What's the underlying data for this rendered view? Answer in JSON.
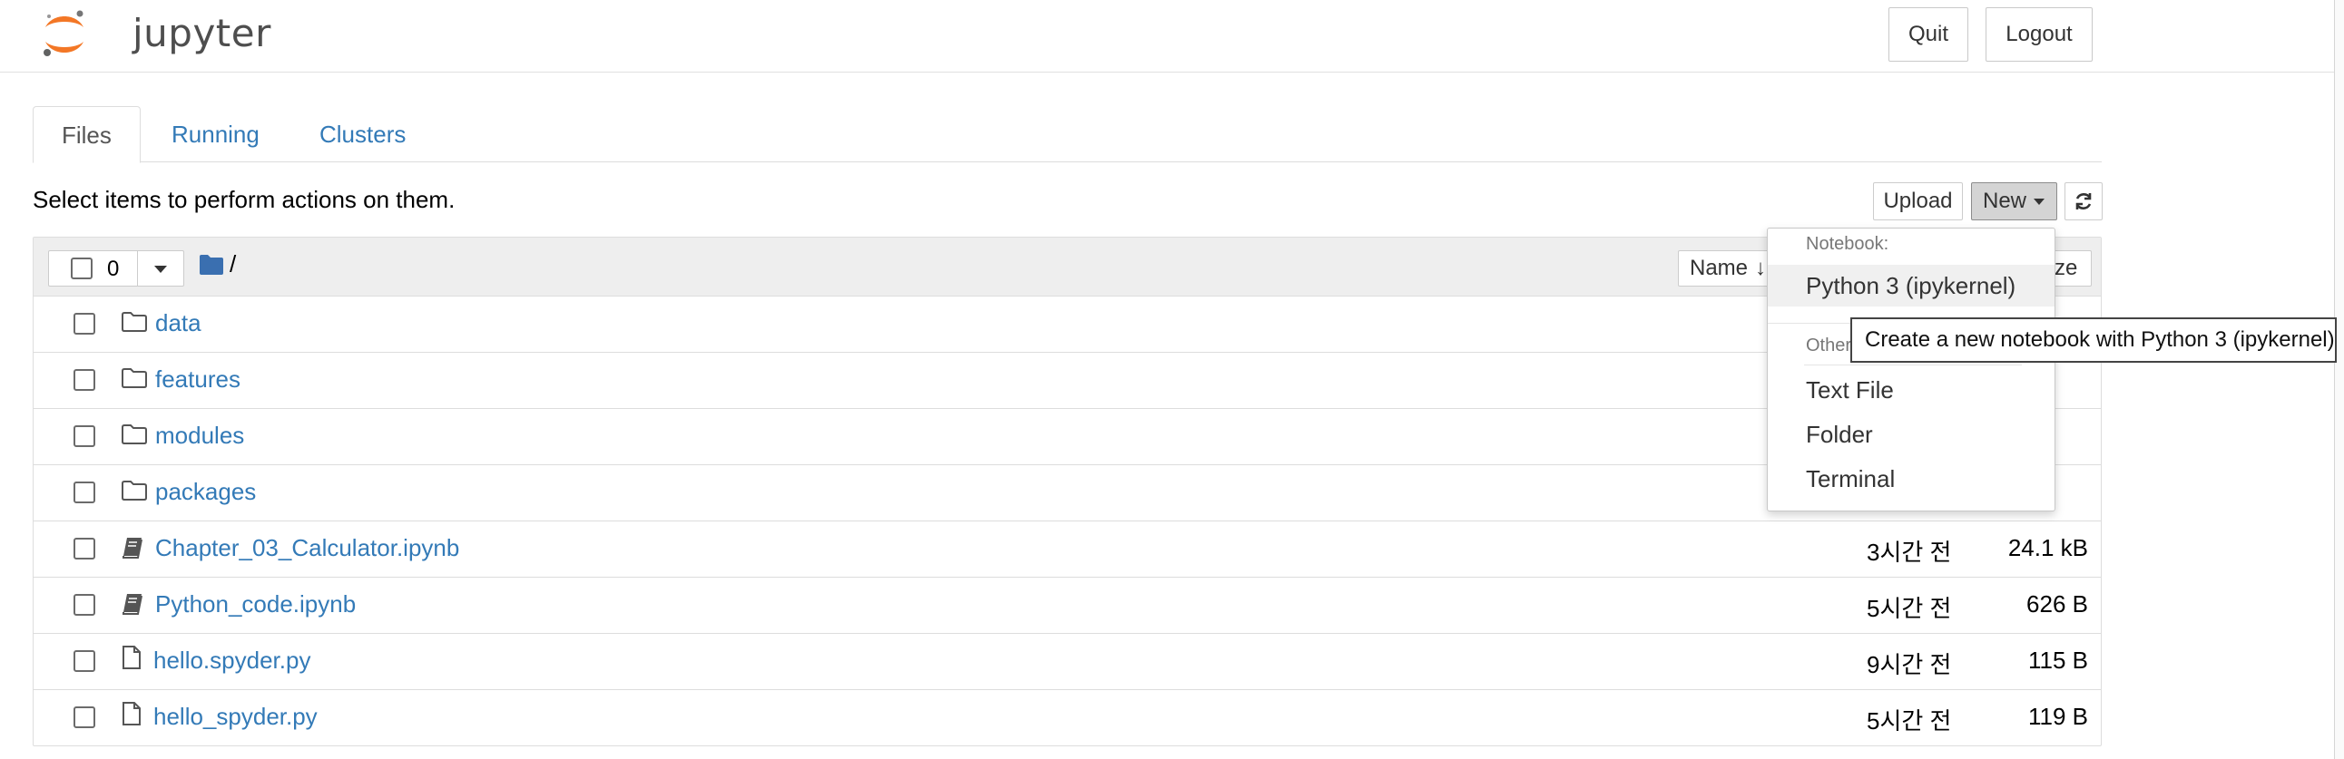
{
  "app": {
    "logo_text": "jupyter",
    "quit_label": "Quit",
    "logout_label": "Logout"
  },
  "tabs": [
    {
      "label": "Files",
      "active": true
    },
    {
      "label": "Running",
      "active": false
    },
    {
      "label": "Clusters",
      "active": false
    }
  ],
  "toolbar": {
    "info_text": "Select items to perform actions on them.",
    "upload_label": "Upload",
    "new_label": "New"
  },
  "list_header": {
    "selected_count": "0",
    "breadcrumb_path": "/",
    "sort_name_label": "Name",
    "sort_size_label_visible": "ze"
  },
  "files": [
    {
      "name": "data",
      "type": "folder",
      "modified": "",
      "size": ""
    },
    {
      "name": "features",
      "type": "folder",
      "modified": "",
      "size": ""
    },
    {
      "name": "modules",
      "type": "folder",
      "modified": "",
      "size": ""
    },
    {
      "name": "packages",
      "type": "folder",
      "modified": "",
      "size": ""
    },
    {
      "name": "Chapter_03_Calculator.ipynb",
      "type": "notebook",
      "modified": "3시간 전",
      "size": "24.1 kB"
    },
    {
      "name": "Python_code.ipynb",
      "type": "notebook",
      "modified": "5시간 전",
      "size": "626 B"
    },
    {
      "name": "hello.spyder.py",
      "type": "file",
      "modified": "9시간 전",
      "size": "115 B"
    },
    {
      "name": "hello_spyder.py",
      "type": "file",
      "modified": "5시간 전",
      "size": "119 B"
    }
  ],
  "new_menu": {
    "notebook_header": "Notebook:",
    "notebook_items": [
      "Python 3 (ipykernel)"
    ],
    "other_header": "Other",
    "other_items": [
      "Text File",
      "Folder",
      "Terminal"
    ]
  },
  "tooltip": {
    "text": "Create a new notebook with Python 3 (ipykernel)"
  },
  "colors": {
    "link": "#337ab7",
    "brand_orange": "#f37726",
    "folder_blue": "#337ab7"
  }
}
